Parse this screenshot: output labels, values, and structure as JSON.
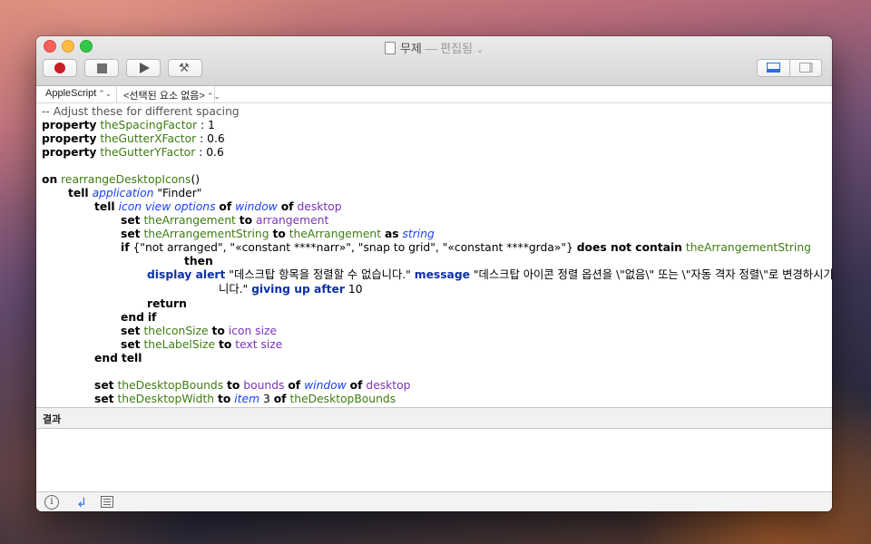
{
  "window": {
    "title": "무제",
    "title_suffix": "— 편집됨",
    "title_chevron": "⌄"
  },
  "toolbar": {
    "record": "record",
    "stop": "stop",
    "run": "run",
    "compile": "compile",
    "hammer_glyph": "⚒"
  },
  "navbar": {
    "language": "AppleScript",
    "element": "<선택된 요소 없음>",
    "arrow": "⌃⌄"
  },
  "code": [
    [
      {
        "t": "-- Adjust these for different spacing",
        "c": "cmt"
      }
    ],
    [
      {
        "t": "property",
        "c": "kw"
      },
      {
        "t": " "
      },
      {
        "t": "theSpacingFactor",
        "c": "var"
      },
      {
        "t": " : 1"
      }
    ],
    [
      {
        "t": "property",
        "c": "kw"
      },
      {
        "t": " "
      },
      {
        "t": "theGutterXFactor",
        "c": "var"
      },
      {
        "t": " : 0.6"
      }
    ],
    [
      {
        "t": "property",
        "c": "kw"
      },
      {
        "t": " "
      },
      {
        "t": "theGutterYFactor",
        "c": "var"
      },
      {
        "t": " : 0.6"
      }
    ],
    [],
    [
      {
        "t": "on",
        "c": "kw"
      },
      {
        "t": " "
      },
      {
        "t": "rearrangeDesktopIcons",
        "c": "var"
      },
      {
        "t": "()"
      }
    ],
    [
      {
        "t": "tell",
        "c": "kw"
      },
      {
        "t": " "
      },
      {
        "t": "application",
        "c": "cls"
      },
      {
        "t": " \"Finder\""
      }
    ],
    [
      {
        "t": "tell",
        "c": "kw"
      },
      {
        "t": " "
      },
      {
        "t": "icon view options",
        "c": "cls"
      },
      {
        "t": " "
      },
      {
        "t": "of",
        "c": "kw"
      },
      {
        "t": " "
      },
      {
        "t": "window",
        "c": "cls"
      },
      {
        "t": " "
      },
      {
        "t": "of",
        "c": "kw"
      },
      {
        "t": " "
      },
      {
        "t": "desktop",
        "c": "prop"
      }
    ],
    [
      {
        "t": "set",
        "c": "kw"
      },
      {
        "t": " "
      },
      {
        "t": "theArrangement",
        "c": "var"
      },
      {
        "t": " "
      },
      {
        "t": "to",
        "c": "kw"
      },
      {
        "t": " "
      },
      {
        "t": "arrangement",
        "c": "prop"
      }
    ],
    [
      {
        "t": "set",
        "c": "kw"
      },
      {
        "t": " "
      },
      {
        "t": "theArrangementString",
        "c": "var"
      },
      {
        "t": " "
      },
      {
        "t": "to",
        "c": "kw"
      },
      {
        "t": " "
      },
      {
        "t": "theArrangement",
        "c": "var"
      },
      {
        "t": " "
      },
      {
        "t": "as",
        "c": "kw"
      },
      {
        "t": " "
      },
      {
        "t": "string",
        "c": "cls"
      }
    ],
    [
      {
        "t": "if",
        "c": "kw"
      },
      {
        "t": " {\"not arranged\", \"«constant ****narr»\", \"snap to grid\", \"«constant ****grda»\"} "
      },
      {
        "t": "does not contain",
        "c": "kw"
      },
      {
        "t": " "
      },
      {
        "t": "theArrangementString",
        "c": "var"
      }
    ],
    [
      {
        "t": "then",
        "c": "kw"
      }
    ],
    [
      {
        "t": "display alert",
        "c": "cmd"
      },
      {
        "t": " \"데스크탑 항목을 정렬할 수 없습니다.\" "
      },
      {
        "t": "message",
        "c": "cmd"
      },
      {
        "t": " \"데스크탑 아이콘 정렬 옵션을 \\\"없음\\\" 또는 \\\"자동 격자 정렬\\\"로 변경하시기 바랍"
      }
    ],
    [
      {
        "t": "니다.\" "
      },
      {
        "t": "giving up after",
        "c": "cmd"
      },
      {
        "t": " 10"
      }
    ],
    [
      {
        "t": "return",
        "c": "kw"
      }
    ],
    [
      {
        "t": "end",
        "c": "kw"
      },
      {
        "t": " "
      },
      {
        "t": "if",
        "c": "kw"
      }
    ],
    [
      {
        "t": "set",
        "c": "kw"
      },
      {
        "t": " "
      },
      {
        "t": "theIconSize",
        "c": "var"
      },
      {
        "t": " "
      },
      {
        "t": "to",
        "c": "kw"
      },
      {
        "t": " "
      },
      {
        "t": "icon size",
        "c": "prop"
      }
    ],
    [
      {
        "t": "set",
        "c": "kw"
      },
      {
        "t": " "
      },
      {
        "t": "theLabelSize",
        "c": "var"
      },
      {
        "t": " "
      },
      {
        "t": "to",
        "c": "kw"
      },
      {
        "t": " "
      },
      {
        "t": "text size",
        "c": "prop"
      }
    ],
    [
      {
        "t": "end",
        "c": "kw"
      },
      {
        "t": " "
      },
      {
        "t": "tell",
        "c": "kw"
      }
    ],
    [],
    [
      {
        "t": "set",
        "c": "kw"
      },
      {
        "t": " "
      },
      {
        "t": "theDesktopBounds",
        "c": "var"
      },
      {
        "t": " "
      },
      {
        "t": "to",
        "c": "kw"
      },
      {
        "t": " "
      },
      {
        "t": "bounds",
        "c": "prop"
      },
      {
        "t": " "
      },
      {
        "t": "of",
        "c": "kw"
      },
      {
        "t": " "
      },
      {
        "t": "window",
        "c": "cls"
      },
      {
        "t": " "
      },
      {
        "t": "of",
        "c": "kw"
      },
      {
        "t": " "
      },
      {
        "t": "desktop",
        "c": "prop"
      }
    ],
    [
      {
        "t": "set",
        "c": "kw"
      },
      {
        "t": " "
      },
      {
        "t": "theDesktopWidth",
        "c": "var"
      },
      {
        "t": " "
      },
      {
        "t": "to",
        "c": "kw"
      },
      {
        "t": " "
      },
      {
        "t": "item",
        "c": "cls"
      },
      {
        "t": " 3 "
      },
      {
        "t": "of",
        "c": "kw"
      },
      {
        "t": " "
      },
      {
        "t": "theDesktopBounds",
        "c": "var"
      }
    ]
  ],
  "results": {
    "label": "결과"
  },
  "bottom_bar": {
    "info_glyph": "i",
    "reply_glyph": "↲"
  }
}
